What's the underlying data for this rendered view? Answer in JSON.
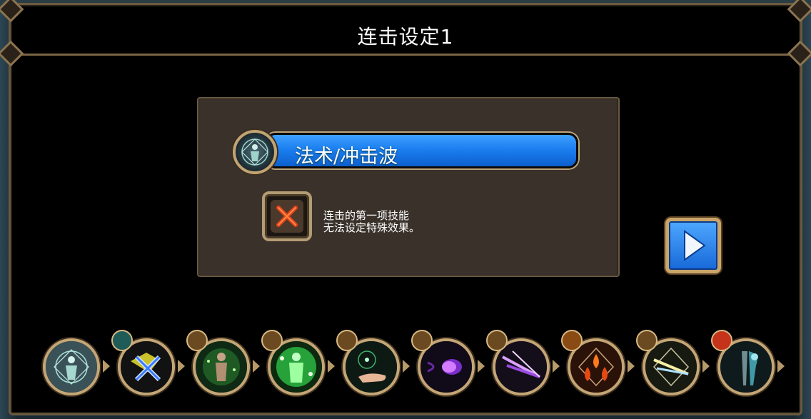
{
  "dialog": {
    "title": "连击设定1"
  },
  "selected_skill": {
    "name": "法术/冲击波",
    "icon": "shockwave-spell-icon"
  },
  "notice": {
    "line1": "连击的第一项技能",
    "line2": "无法设定特殊效果。",
    "icon": "cross-icon"
  },
  "buttons": {
    "next_icon": "play-arrow-icon"
  },
  "combo_slots": [
    {
      "icon": "shockwave-spell-icon",
      "badge": "none"
    },
    {
      "icon": "cross-slash-icon",
      "badge": "potion-icon"
    },
    {
      "icon": "green-aura-figure-icon",
      "badge": "chain-arrow-icon"
    },
    {
      "icon": "green-burst-figure-icon",
      "badge": "chain-arrow-icon"
    },
    {
      "icon": "open-palm-icon",
      "badge": "chain-arrow-icon"
    },
    {
      "icon": "purple-orb-icon",
      "badge": "chain-arrow-icon"
    },
    {
      "icon": "purple-arrows-icon",
      "badge": "chain-arrow-icon"
    },
    {
      "icon": "fire-drops-icon",
      "badge": "fist-icon"
    },
    {
      "icon": "yellow-arrows-icon",
      "badge": "chain-arrow-icon"
    },
    {
      "icon": "staff-icon",
      "badge": "explosion-icon"
    }
  ],
  "colors": {
    "accent_blue": "#1b7ff0",
    "frame_gold": "#c4a676",
    "panel_brown": "#39312a"
  }
}
